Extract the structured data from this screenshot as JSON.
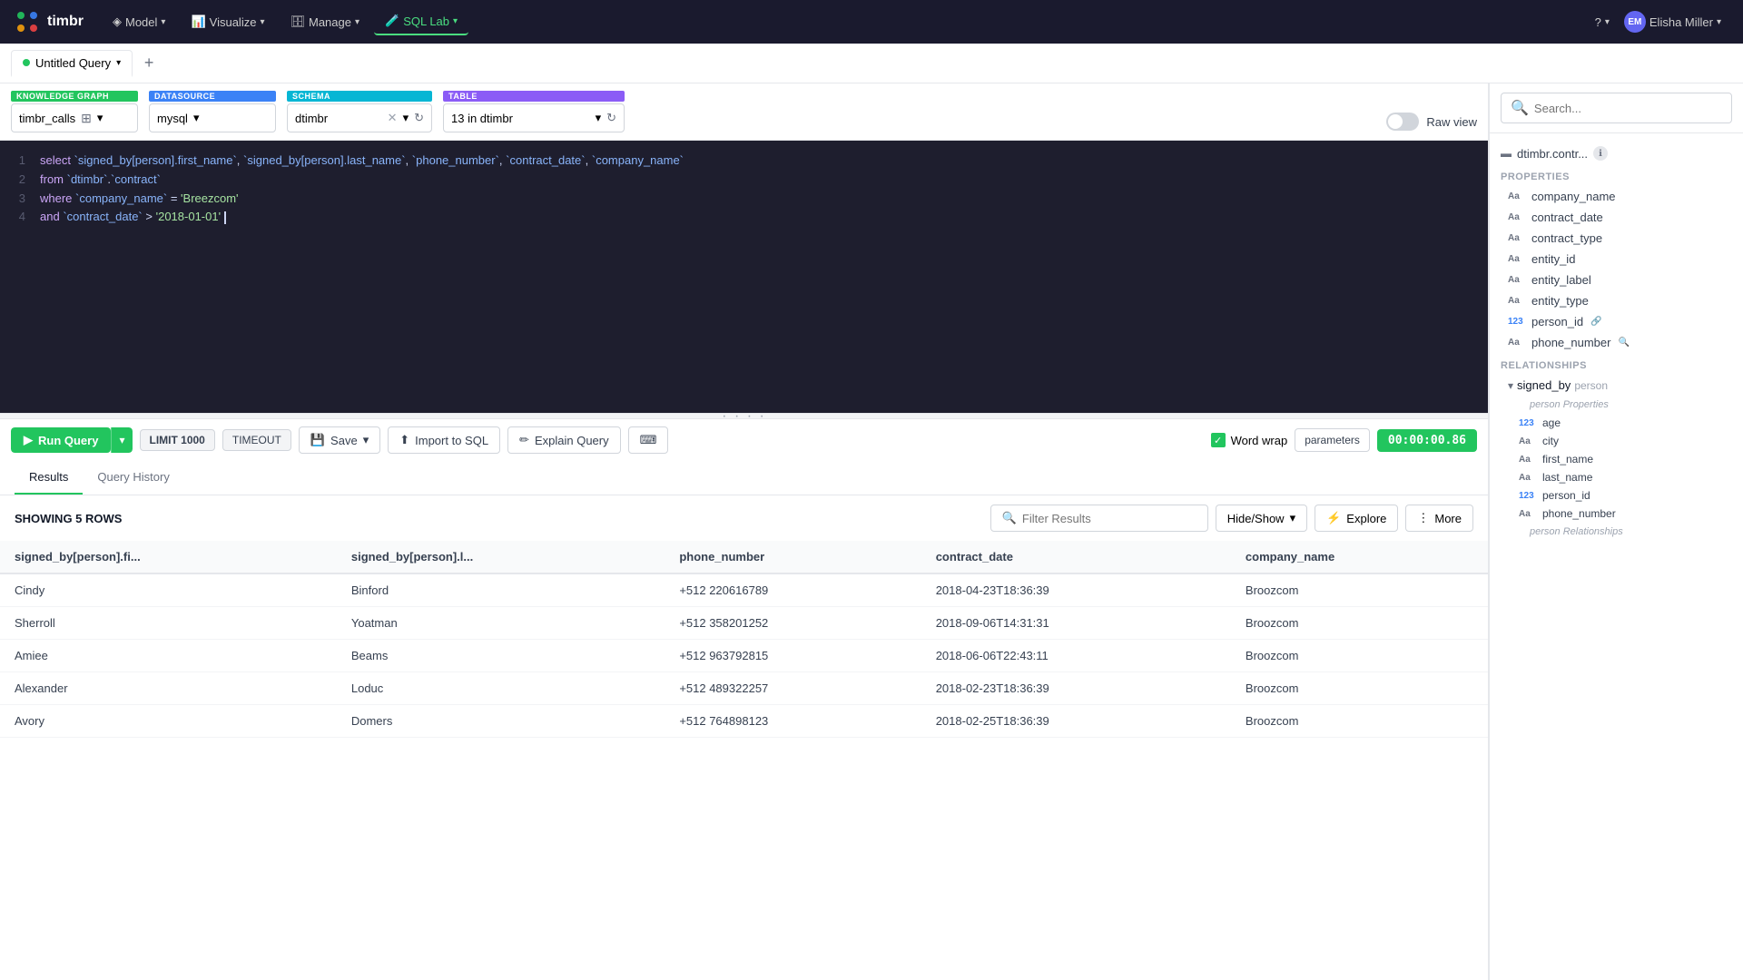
{
  "app": {
    "logo": "timbr",
    "nav_items": [
      {
        "label": "Model",
        "active": false
      },
      {
        "label": "Visualize",
        "active": false
      },
      {
        "label": "Manage",
        "active": false
      },
      {
        "label": "SQL Lab",
        "active": true
      }
    ],
    "help_label": "?",
    "user": {
      "name": "Elisha Miller",
      "initials": "EM"
    }
  },
  "tab": {
    "label": "Untitled Query",
    "add_icon": "+"
  },
  "datasource": {
    "kg_label": "KNOWLEDGE GRAPH",
    "kg_value": "timbr_calls",
    "ds_label": "DATASOURCE",
    "ds_value": "mysql",
    "schema_label": "SCHEMA",
    "schema_value": "dtimbr",
    "table_label": "TABLE",
    "table_value": "13 in dtimbr",
    "raw_view_label": "Raw view"
  },
  "editor": {
    "lines": [
      {
        "num": "1",
        "content": "select `signed_by[person].first_name`, `signed_by[person].last_name`, `phone_number`, `contract_date`, `company_name`"
      },
      {
        "num": "2",
        "content": "from `dtimbr`.`contract`"
      },
      {
        "num": "3",
        "content": "where `company_name` = 'Breezcom'"
      },
      {
        "num": "4",
        "content": "and `contract_date` > '2018-01-01'"
      }
    ]
  },
  "toolbar": {
    "run_label": "Run Query",
    "limit_label": "LIMIT 1000",
    "timeout_label": "TIMEOUT",
    "save_label": "Save",
    "import_label": "Import to SQL",
    "explain_label": "Explain Query",
    "word_wrap_label": "Word wrap",
    "params_label": "parameters",
    "timer": "00:00:00.86"
  },
  "results": {
    "tab_results": "Results",
    "tab_history": "Query History",
    "showing": "SHOWING 5 ROWS",
    "filter_placeholder": "Filter Results",
    "hide_show": "Hide/Show",
    "explore": "Explore",
    "more": "More",
    "columns": [
      "signed_by[person].fi...",
      "signed_by[person].l...",
      "phone_number",
      "contract_date",
      "company_name"
    ],
    "rows": [
      [
        "Cindy",
        "Binford",
        "+512 220616789",
        "2018-04-23T18:36:39",
        "Broozcom"
      ],
      [
        "Sherroll",
        "Yoatman",
        "+512 358201252",
        "2018-09-06T14:31:31",
        "Broozcom"
      ],
      [
        "Amiee",
        "Beams",
        "+512 963792815",
        "2018-06-06T22:43:11",
        "Broozcom"
      ],
      [
        "Alexander",
        "Loduc",
        "+512 489322257",
        "2018-02-23T18:36:39",
        "Broozcom"
      ],
      [
        "Avory",
        "Domers",
        "+512 764898123",
        "2018-02-25T18:36:39",
        "Broozcom"
      ]
    ]
  },
  "sidebar": {
    "search_placeholder": "Search...",
    "table_name": "dtimbr.contr...",
    "properties_label": "PROPERTIES",
    "properties": [
      {
        "type": "Aa",
        "name": "company_name",
        "is_num": false
      },
      {
        "type": "Aa",
        "name": "contract_date",
        "is_num": false
      },
      {
        "type": "Aa",
        "name": "contract_type",
        "is_num": false
      },
      {
        "type": "Aa",
        "name": "entity_id",
        "is_num": false
      },
      {
        "type": "Aa",
        "name": "entity_label",
        "is_num": false
      },
      {
        "type": "Aa",
        "name": "entity_type",
        "is_num": false
      },
      {
        "type": "123",
        "name": "person_id",
        "is_num": true,
        "has_link": true
      },
      {
        "type": "Aa",
        "name": "phone_number",
        "is_num": false,
        "has_search": true
      }
    ],
    "relationships_label": "RELATIONSHIPS",
    "relationship": {
      "arrow": "▾",
      "name": "signed_by",
      "type": "person",
      "sub_label_props": "person Properties",
      "sub_props": [
        {
          "type": "123",
          "name": "age",
          "is_num": true
        },
        {
          "type": "Aa",
          "name": "city"
        },
        {
          "type": "Aa",
          "name": "first_name"
        },
        {
          "type": "Aa",
          "name": "last_name"
        },
        {
          "type": "123",
          "name": "person_id",
          "is_num": true
        },
        {
          "type": "Aa",
          "name": "phone_number"
        }
      ],
      "sub_label_rels": "person Relationships"
    }
  }
}
